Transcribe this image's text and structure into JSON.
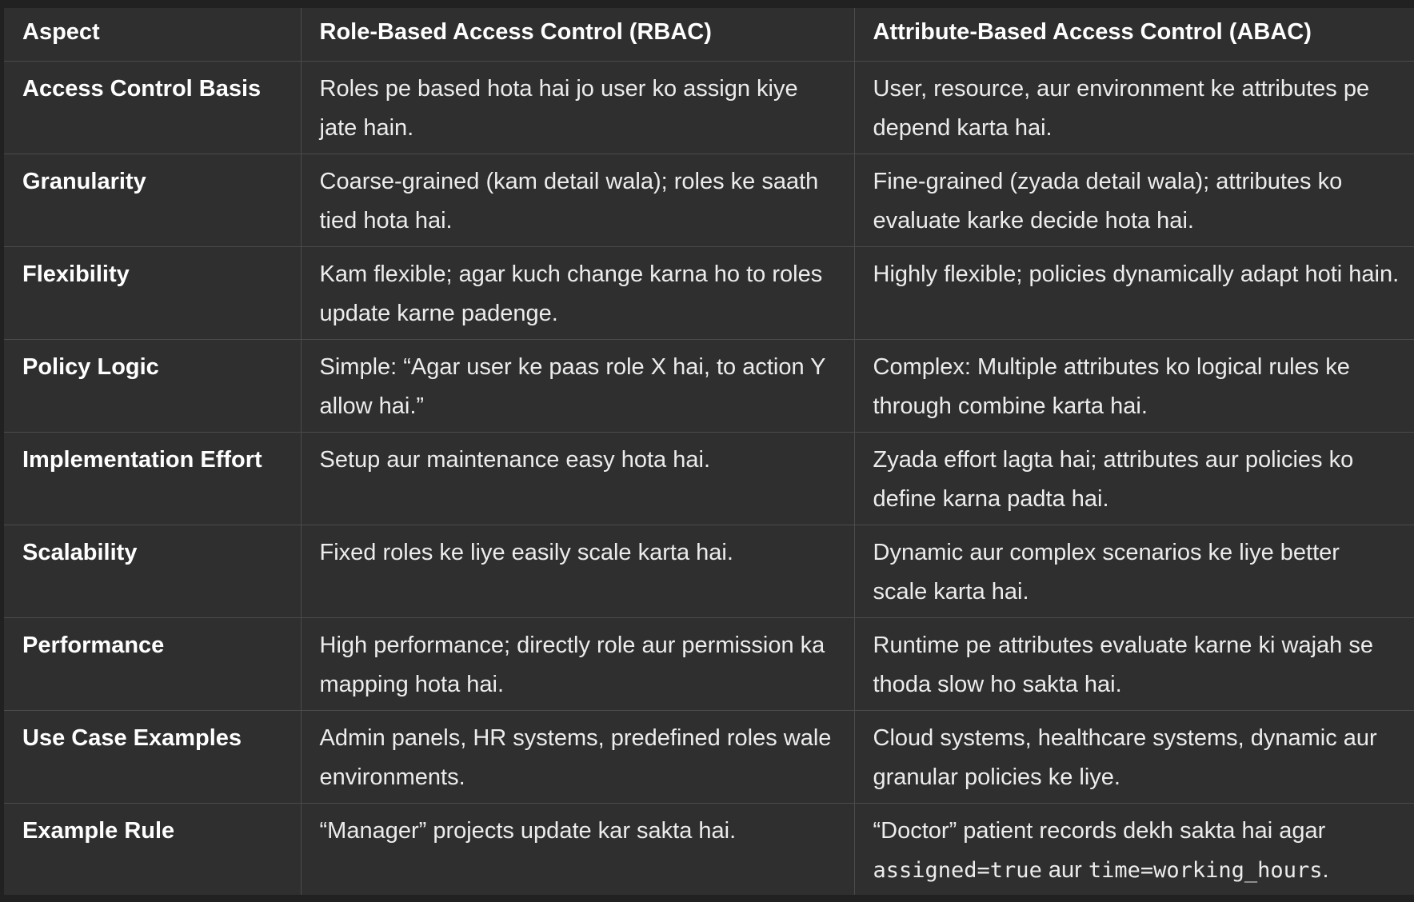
{
  "table": {
    "headers": [
      "Aspect",
      "Role-Based Access Control (RBAC)",
      "Attribute-Based Access Control (ABAC)"
    ],
    "rows": [
      {
        "aspect": "Access Control Basis",
        "rbac": "Roles pe based hota hai jo user ko assign kiye jate hain.",
        "abac": "User, resource, aur environment ke attributes pe depend karta hai."
      },
      {
        "aspect": "Granularity",
        "rbac": "Coarse-grained (kam detail wala); roles ke saath tied hota hai.",
        "abac": "Fine-grained (zyada detail wala); attributes ko evaluate karke decide hota hai."
      },
      {
        "aspect": "Flexibility",
        "rbac": "Kam flexible; agar kuch change karna ho to roles update karne padenge.",
        "abac": "Highly flexible; policies dynamically adapt hoti hain."
      },
      {
        "aspect": "Policy Logic",
        "rbac": "Simple: “Agar user ke paas role X hai, to action Y allow hai.”",
        "abac": "Complex: Multiple attributes ko logical rules ke through combine karta hai."
      },
      {
        "aspect": "Implementation Effort",
        "rbac": "Setup aur maintenance easy hota hai.",
        "abac": "Zyada effort lagta hai; attributes aur policies ko define karna padta hai."
      },
      {
        "aspect": "Scalability",
        "rbac": "Fixed roles ke liye easily scale karta hai.",
        "abac": "Dynamic aur complex scenarios ke liye better scale karta hai."
      },
      {
        "aspect": "Performance",
        "rbac": "High performance; directly role aur permission ka mapping hota hai.",
        "abac": "Runtime pe attributes evaluate karne ki wajah se thoda slow ho sakta hai."
      },
      {
        "aspect": "Use Case Examples",
        "rbac": "Admin panels, HR systems, predefined roles wale environments.",
        "abac": "Cloud systems, healthcare systems, dynamic aur granular policies ke liye."
      },
      {
        "aspect": "Example Rule",
        "rbac": "“Manager” projects update kar sakta hai.",
        "abac_parts": {
          "prefix": "“Doctor” patient records dekh sakta hai agar ",
          "code1": "assigned=true",
          "middle": " aur ",
          "code2": "time=working_hours",
          "suffix": "."
        }
      }
    ]
  }
}
